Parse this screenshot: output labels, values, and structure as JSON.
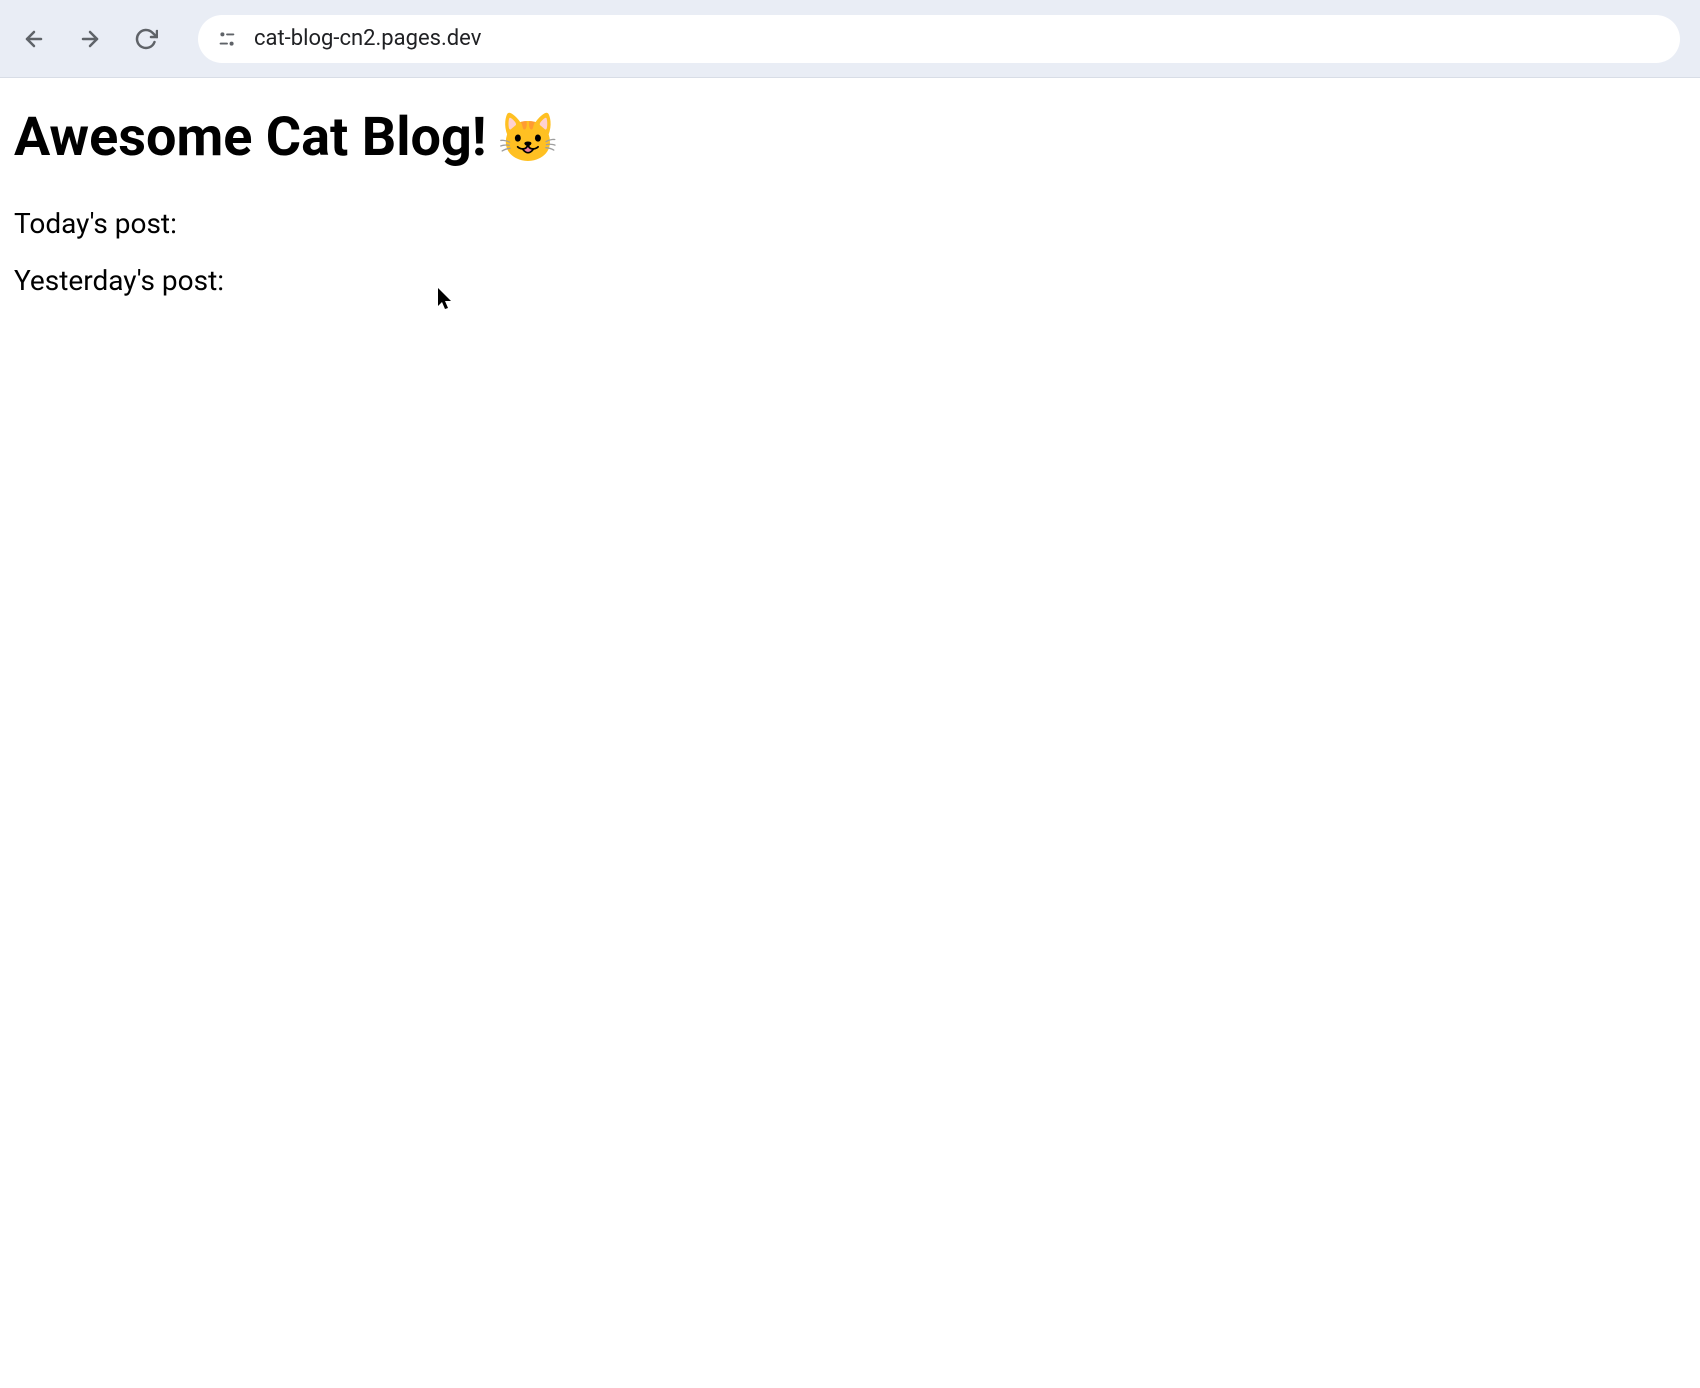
{
  "browser": {
    "url": "cat-blog-cn2.pages.dev"
  },
  "page": {
    "title": "Awesome Cat Blog! ",
    "title_emoji": "😺",
    "today_post_label": "Today's post:",
    "yesterday_post_label": "Yesterday's post:"
  }
}
